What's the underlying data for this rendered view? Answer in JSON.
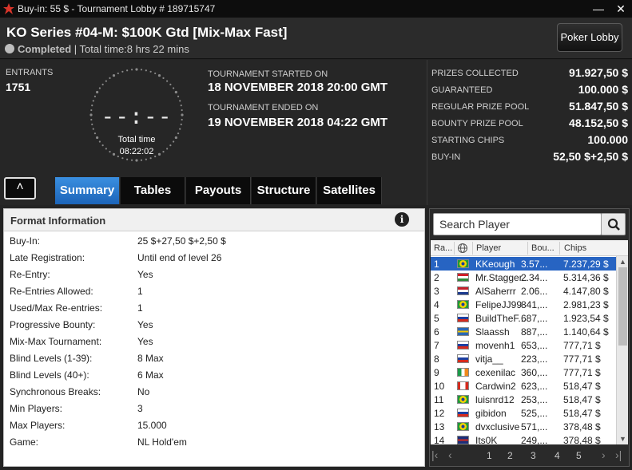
{
  "window": {
    "title": "Buy-in: 55 $ - Tournament Lobby # 189715747",
    "minimize": "—",
    "close": "✕"
  },
  "header": {
    "event_title": "KO Series #04-M: $100K Gtd [Mix-Max Fast]",
    "status": "Completed",
    "total_time": "| Total time:8 hrs  22 mins",
    "poker_lobby": "Poker Lobby"
  },
  "info": {
    "entrants_label": "ENTRANTS",
    "entrants_value": "1751",
    "clock_digits": "--:--",
    "total_time_label": "Total time",
    "total_time_value": "08:22:02",
    "started_label": "TOURNAMENT STARTED ON",
    "started_value": "18 NOVEMBER 2018  20:00 GMT",
    "ended_label": "TOURNAMENT ENDED ON",
    "ended_value": "19 NOVEMBER 2018  04:22 GMT"
  },
  "prizes": [
    {
      "label": "PRIZES COLLECTED",
      "value": "91.927,50 $"
    },
    {
      "label": "GUARANTEED",
      "value": "100.000 $"
    },
    {
      "label": "REGULAR PRIZE POOL",
      "value": "51.847,50 $"
    },
    {
      "label": "BOUNTY PRIZE POOL",
      "value": "48.152,50 $"
    },
    {
      "label": "STARTING CHIPS",
      "value": "100.000"
    },
    {
      "label": "BUY-IN",
      "value": "52,50 $+2,50 $"
    }
  ],
  "tabs": [
    "Summary",
    "Tables",
    "Payouts",
    "Structure",
    "Satellites"
  ],
  "collapse_icon": "˄",
  "format": {
    "title": "Format Information",
    "info_icon": "i",
    "rows": [
      {
        "k": "Buy-In:",
        "v": "25 $+27,50 $+2,50 $"
      },
      {
        "k": "Late Registration:",
        "v": "Until end of level 26"
      },
      {
        "k": "Re-Entry:",
        "v": "Yes"
      },
      {
        "k": "Re-Entries Allowed:",
        "v": "1"
      },
      {
        "k": "Used/Max Re-entries:",
        "v": "1"
      },
      {
        "k": "Progressive Bounty:",
        "v": "Yes"
      },
      {
        "k": "Mix-Max Tournament:",
        "v": "Yes"
      },
      {
        "k": "Blind Levels (1-39):",
        "v": "8 Max"
      },
      {
        "k": "Blind Levels (40+):",
        "v": "6 Max"
      },
      {
        "k": "Synchronous Breaks:",
        "v": "No"
      },
      {
        "k": "Min Players:",
        "v": "3"
      },
      {
        "k": "Max Players:",
        "v": "15.000"
      },
      {
        "k": "Game:",
        "v": "NL Hold'em"
      }
    ]
  },
  "players": {
    "search_placeholder": "Search Player",
    "columns": {
      "rank": "Ra...",
      "player": "Player",
      "bounty": "Bou...",
      "chips": "Chips"
    },
    "rows": [
      {
        "rank": "1",
        "flag": "brazil",
        "name": "KKeough",
        "bounty": "3.57...",
        "chips": "7.237,29 $",
        "selected": true
      },
      {
        "rank": "2",
        "flag": "hungary",
        "name": "Mr.Stagger..",
        "bounty": "2.34...",
        "chips": "5.314,36 $"
      },
      {
        "rank": "3",
        "flag": "netherlands",
        "name": "AlSaherrr",
        "bounty": "2.06...",
        "chips": "4.147,80 $"
      },
      {
        "rank": "4",
        "flag": "brazil",
        "name": "FelipeJJ99",
        "bounty": "841,...",
        "chips": "2.981,23 $"
      },
      {
        "rank": "5",
        "flag": "russia",
        "name": "BuildTheF...",
        "bounty": "687,...",
        "chips": "1.923,54 $"
      },
      {
        "rank": "6",
        "flag": "sweden",
        "name": "Slaassh",
        "bounty": "887,...",
        "chips": "1.140,64 $"
      },
      {
        "rank": "7",
        "flag": "russia",
        "name": "movenh1",
        "bounty": "653,...",
        "chips": "777,71 $"
      },
      {
        "rank": "8",
        "flag": "russia",
        "name": "vitja__",
        "bounty": "223,...",
        "chips": "777,71 $"
      },
      {
        "rank": "9",
        "flag": "ireland",
        "name": "cexenilac",
        "bounty": "360,...",
        "chips": "777,71 $"
      },
      {
        "rank": "10",
        "flag": "canada",
        "name": "Cardwin2",
        "bounty": "623,...",
        "chips": "518,47 $"
      },
      {
        "rank": "11",
        "flag": "brazil",
        "name": "luisnrd12",
        "bounty": "253,...",
        "chips": "518,47 $"
      },
      {
        "rank": "12",
        "flag": "russia",
        "name": "gibidon",
        "bounty": "525,...",
        "chips": "518,47 $"
      },
      {
        "rank": "13",
        "flag": "brazil",
        "name": "dvxclusive",
        "bounty": "571,...",
        "chips": "378,48 $"
      },
      {
        "rank": "14",
        "flag": "uk",
        "name": "Its0K",
        "bounty": "249,...",
        "chips": "378,48 $"
      }
    ],
    "pages": [
      "1",
      "2",
      "3",
      "4",
      "5"
    ],
    "nav_first": "|‹",
    "nav_prev": "‹",
    "nav_next": "›",
    "nav_last": "›|"
  },
  "colors": {
    "accent": "#2764c2",
    "tab_active": "#2a7ad4",
    "background": "#232323"
  }
}
